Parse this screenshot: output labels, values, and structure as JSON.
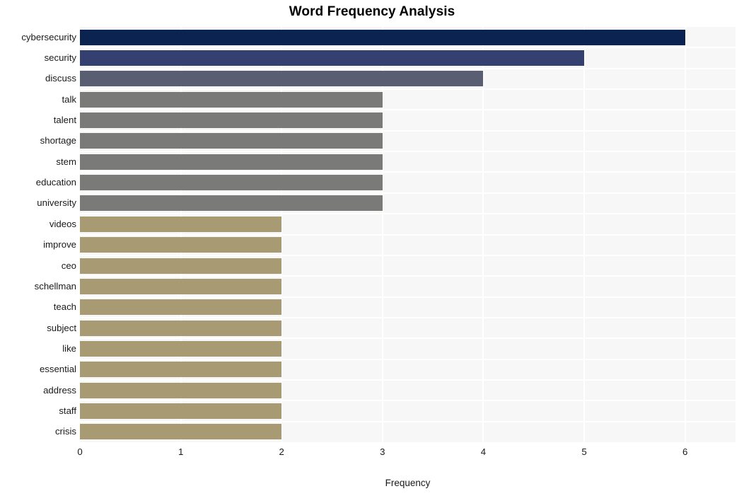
{
  "chart_data": {
    "type": "bar",
    "orientation": "horizontal",
    "title": "Word Frequency Analysis",
    "xlabel": "Frequency",
    "ylabel": "",
    "xlim": [
      0,
      6.5
    ],
    "xticks": [
      "0",
      "1",
      "2",
      "3",
      "4",
      "5",
      "6"
    ],
    "xtick_values": [
      0,
      1,
      2,
      3,
      4,
      5,
      6
    ],
    "grid": true,
    "legend": "none",
    "categories": [
      "cybersecurity",
      "security",
      "discuss",
      "talk",
      "talent",
      "shortage",
      "stem",
      "education",
      "university",
      "videos",
      "improve",
      "ceo",
      "schellman",
      "teach",
      "subject",
      "like",
      "essential",
      "address",
      "staff",
      "crisis"
    ],
    "values": [
      6,
      5,
      4,
      3,
      3,
      3,
      3,
      3,
      3,
      2,
      2,
      2,
      2,
      2,
      2,
      2,
      2,
      2,
      2,
      2
    ],
    "bar_colors": [
      "#0a2350",
      "#334070",
      "#5a5e72",
      "#7a7a78",
      "#7a7a78",
      "#7a7a78",
      "#7a7a78",
      "#7a7a78",
      "#7a7a78",
      "#a89a72",
      "#a89a72",
      "#a89a72",
      "#a89a72",
      "#a89a72",
      "#a89a72",
      "#a89a72",
      "#a89a72",
      "#a89a72",
      "#a89a72",
      "#a89a72"
    ]
  },
  "style": {
    "figure_background": "#ffffff",
    "plot_background": "#f7f7f7",
    "grid_color": "#ffffff",
    "text_color": "#1a1a1a",
    "title_color": "#000000"
  }
}
